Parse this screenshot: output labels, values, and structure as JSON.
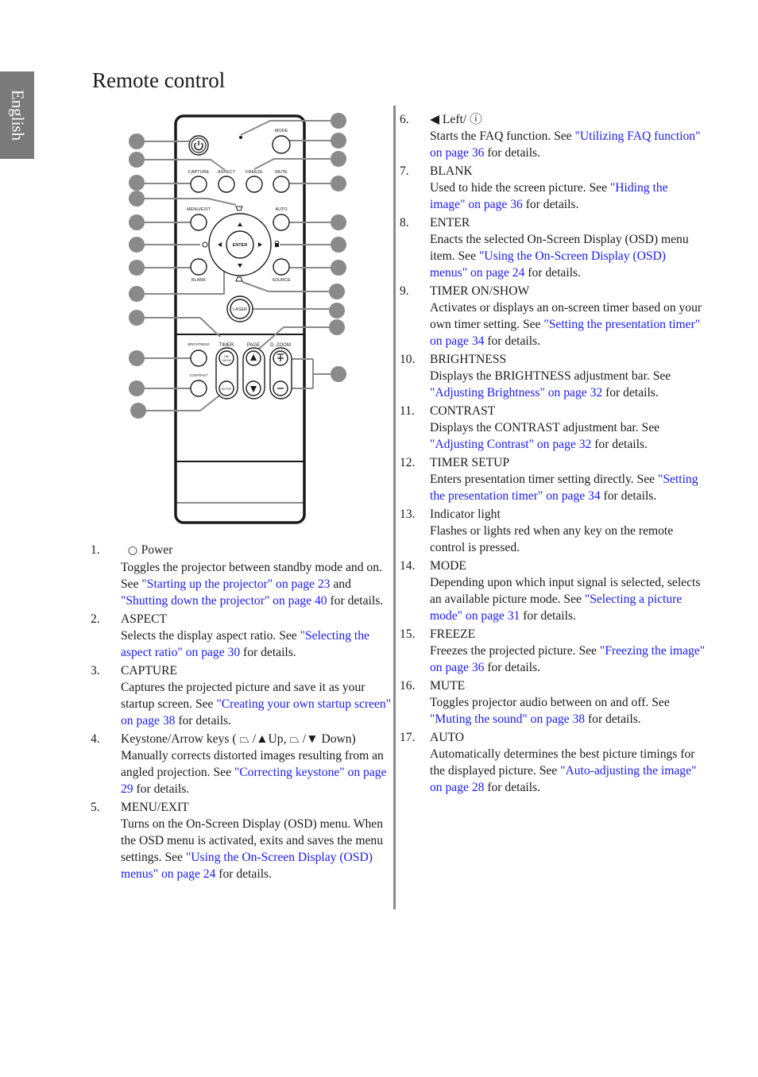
{
  "side_tab": "English",
  "title": "Remote control",
  "remote_labels": {
    "mode": "MODE",
    "capture": "CAPTURE",
    "aspect": "ASPECT",
    "freeze": "FREEZE",
    "mute": "MUTE",
    "menu_exit": "MENU/EXIT",
    "auto": "AUTO",
    "enter": "ENTER",
    "blank": "BLANK",
    "source": "SOURCE",
    "laser": "LASER",
    "brightness": "BRIGHTNESS",
    "timer": "TIMER",
    "page": "PAGE",
    "dzoom": "D. ZOOM",
    "contrast": "CONTRAST",
    "on": "ON/",
    "show": "SHOW",
    "setup": "SETUP",
    "plus": "+",
    "minus": "−"
  },
  "items_left": [
    {
      "num": "1.",
      "title": "Power",
      "icon": "power-circle-icon",
      "body": [
        {
          "t": "Toggles the projector between standby mode and on. See "
        },
        {
          "t": "\"Starting up the projector\" on page 23",
          "link": true
        },
        {
          "t": " and "
        },
        {
          "t": "\"Shutting down the projector\" on page 40",
          "link": true
        },
        {
          "t": " for details."
        }
      ]
    },
    {
      "num": "2.",
      "title": "ASPECT",
      "body": [
        {
          "t": "Selects the display aspect ratio. See "
        },
        {
          "t": "\"Selecting the aspect ratio\" on page 30",
          "link": true
        },
        {
          "t": " for details."
        }
      ]
    },
    {
      "num": "3.",
      "title": "CAPTURE",
      "body": [
        {
          "t": "Captures the projected picture and save it as your startup screen. See "
        },
        {
          "t": "\"Creating your own startup screen\" on page 38",
          "link": true
        },
        {
          "t": " for details."
        }
      ]
    },
    {
      "num": "4.",
      "title": "Keystone/Arrow keys ( ⏢ /▲Up,  ⏢ /▼ Down)",
      "body": [
        {
          "t": "Manually corrects distorted images resulting from an angled projection. See "
        },
        {
          "t": "\"Correcting keystone\" on page 29",
          "link": true
        },
        {
          "t": " for details."
        }
      ]
    },
    {
      "num": "5.",
      "title": "MENU/EXIT",
      "body": [
        {
          "t": "Turns on the On-Screen Display (OSD) menu. When the OSD menu is activated, exits and saves the menu settings. See "
        },
        {
          "t": "\"Using the On-Screen Display (OSD) menus\" on page 24",
          "link": true
        },
        {
          "t": " for details."
        }
      ]
    }
  ],
  "items_right": [
    {
      "num": "6.",
      "title": "◀ Left/ ⓘ",
      "body": [
        {
          "t": "Starts the FAQ function. See "
        },
        {
          "t": "\"Utilizing FAQ function\" on page 36",
          "link": true
        },
        {
          "t": " for details."
        }
      ]
    },
    {
      "num": "7.",
      "title": "BLANK",
      "body": [
        {
          "t": "Used to hide the screen picture. See "
        },
        {
          "t": "\"Hiding the image\" on page 36",
          "link": true
        },
        {
          "t": " for details."
        }
      ]
    },
    {
      "num": "8.",
      "title": "ENTER",
      "body": [
        {
          "t": "Enacts the selected On-Screen Display (OSD) menu item. See "
        },
        {
          "t": "\"Using the On-Screen Display (OSD) menus\" on page 24",
          "link": true
        },
        {
          "t": " for details."
        }
      ]
    },
    {
      "num": "9.",
      "title": "TIMER ON/SHOW",
      "body": [
        {
          "t": "Activates or displays an on-screen timer based on your own timer setting. See "
        },
        {
          "t": "\"Setting the presentation timer\" on page 34",
          "link": true
        },
        {
          "t": " for details."
        }
      ]
    },
    {
      "num": "10.",
      "title": "BRIGHTNESS",
      "body": [
        {
          "t": "Displays the "
        },
        {
          "t": "BRIGHTNESS",
          "strong": true
        },
        {
          "t": " adjustment bar. See "
        },
        {
          "t": "\"Adjusting Brightness\" on page 32",
          "link": true
        },
        {
          "t": " for details."
        }
      ]
    },
    {
      "num": "11.",
      "title": "CONTRAST",
      "body": [
        {
          "t": "Displays the "
        },
        {
          "t": "CONTRAST",
          "strong": true
        },
        {
          "t": " adjustment bar. See "
        },
        {
          "t": "\"Adjusting Contrast\" on page 32",
          "link": true
        },
        {
          "t": " for details."
        }
      ]
    },
    {
      "num": "12.",
      "title": "TIMER SETUP",
      "body": [
        {
          "t": "Enters presentation timer setting directly. See "
        },
        {
          "t": "\"Setting the presentation timer\" on page 34",
          "link": true
        },
        {
          "t": " for details."
        }
      ]
    },
    {
      "num": "13.",
      "title": "Indicator light",
      "body": [
        {
          "t": "Flashes or lights red when any key on the remote control is pressed."
        }
      ]
    },
    {
      "num": "14.",
      "title": "MODE",
      "body": [
        {
          "t": "Depending upon which input signal is selected, selects an available picture mode. See "
        },
        {
          "t": "\"Selecting a picture mode\" on page 31",
          "link": true
        },
        {
          "t": " for details."
        }
      ]
    },
    {
      "num": "15.",
      "title": "FREEZE",
      "body": [
        {
          "t": "Freezes the projected picture. See "
        },
        {
          "t": "\"Freezing the image\" on page 36",
          "link": true
        },
        {
          "t": " for details."
        }
      ]
    },
    {
      "num": "16.",
      "title": "MUTE",
      "body": [
        {
          "t": "Toggles projector audio between on and off. See "
        },
        {
          "t": "\"Muting the sound\" on page 38",
          "link": true
        },
        {
          "t": " for details."
        }
      ]
    },
    {
      "num": "17.",
      "title": "AUTO",
      "body": [
        {
          "t": "Automatically determines the best picture timings for the displayed picture. See "
        },
        {
          "t": "\"Auto-adjusting the image\" on page 28",
          "link": true
        },
        {
          "t": " for details."
        }
      ]
    }
  ]
}
